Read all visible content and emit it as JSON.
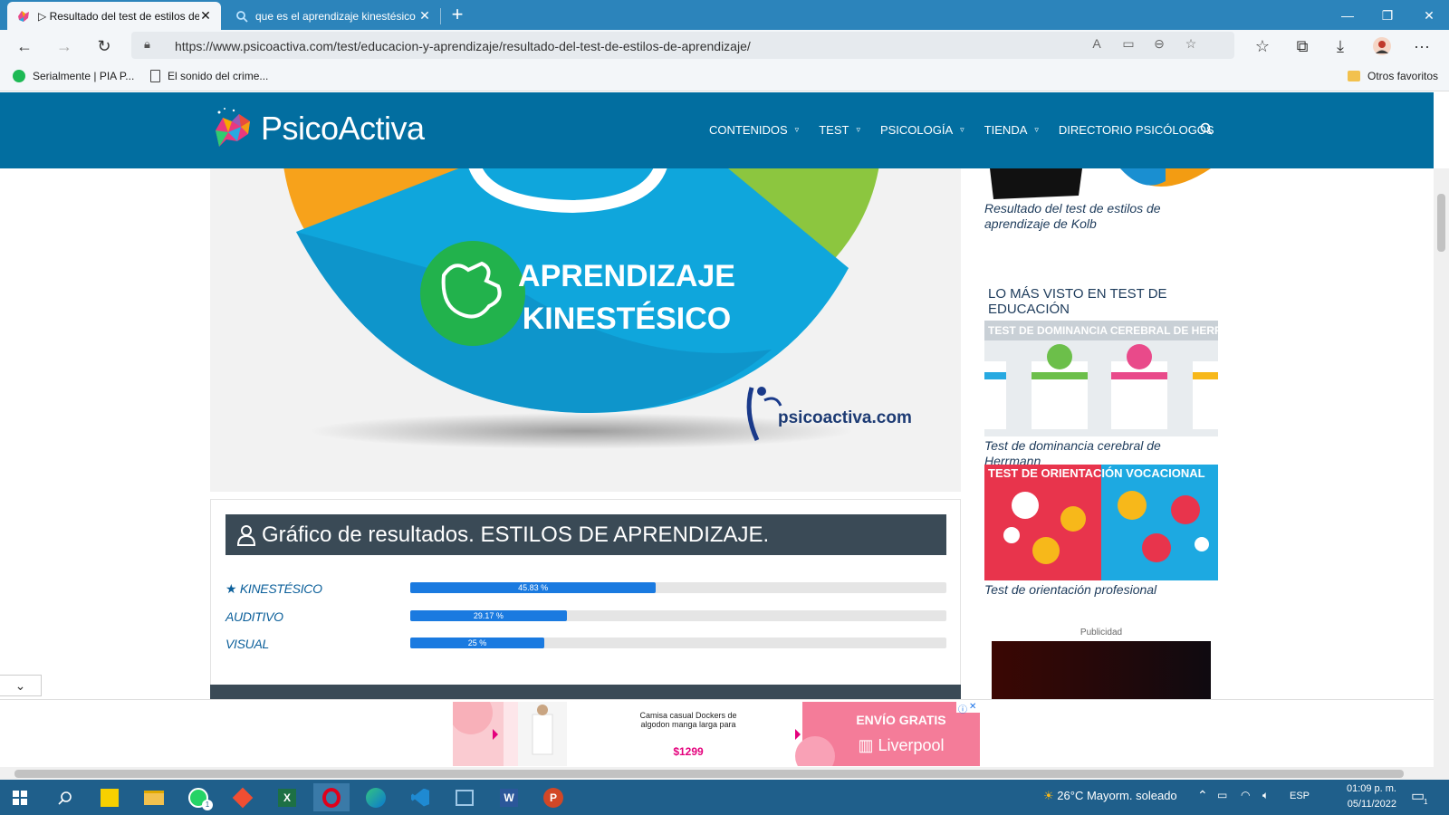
{
  "browser": {
    "tabs": [
      {
        "title": "▷ Resultado del test de estilos de aprendizaje",
        "active": true
      },
      {
        "title": "que es el aprendizaje kinestésico",
        "active": false
      }
    ],
    "url": "https://www.psicoactiva.com/test/educacion-y-aprendizaje/resultado-del-test-de-estilos-de-aprendizaje/",
    "bookmarks": [
      {
        "label": "Serialmente | PIA P...",
        "icon": "spotify-icon"
      },
      {
        "label": "El sonido del crime...",
        "icon": "document-icon"
      }
    ],
    "other_favorites": "Otros favoritos"
  },
  "site": {
    "logo_text": "PsicoActiva",
    "nav": [
      {
        "label": "CONTENIDOS",
        "has_dropdown": true
      },
      {
        "label": "TEST",
        "has_dropdown": true
      },
      {
        "label": "PSICOLOGÍA",
        "has_dropdown": true
      },
      {
        "label": "TIENDA",
        "has_dropdown": true
      },
      {
        "label": "DIRECTORIO PSICÓLOGOS",
        "has_dropdown": false
      }
    ]
  },
  "hero": {
    "line1": "APRENDIZAJE",
    "line2": "KINESTÉSICO",
    "brand": "psicoactiva.com"
  },
  "results": {
    "title": "Gráfico de resultados. ESTILOS DE APRENDIZAJE.",
    "items": [
      {
        "label": "KINESTÉSICO",
        "percent": 45.83,
        "percent_label": "45.83 %",
        "starred": true
      },
      {
        "label": "AUDITIVO",
        "percent": 29.17,
        "percent_label": "29.17 %",
        "starred": false
      },
      {
        "label": "VISUAL",
        "percent": 25,
        "percent_label": "25 %",
        "starred": false
      }
    ],
    "bar_color": "#1a7ae0"
  },
  "sidebar": {
    "top_caption": "Resultado del test de estilos de aprendizaje de Kolb",
    "heading": "LO MÁS VISTO EN TEST DE EDUCACIÓN",
    "cards": [
      {
        "image_text": "TEST DE DOMINANCIA CEREBRAL DE HERRMANN",
        "caption": "Test de dominancia cerebral de Herrmann"
      },
      {
        "image_text": "TEST DE ORIENTACIÓN VOCACIONAL",
        "caption": "Test de orientación profesional"
      }
    ],
    "ad_label": "Publicidad"
  },
  "ad_banner": {
    "product": "Camisa casual Dockers de algodon manga larga para",
    "price": "$1299",
    "promo": "ENVÍO GRATIS",
    "store": "Liverpool"
  },
  "taskbar": {
    "weather": "26°C  Mayorm. soleado",
    "lang": "ESP",
    "time": "01:09 p. m.",
    "date": "05/11/2022",
    "whatsapp_badge": "1",
    "notifications": "1"
  },
  "colors": {
    "site_header": "#026ea0",
    "section_header": "#3a4a56",
    "taskbar": "#1f5f8b",
    "tabbar": "#2c84bb"
  }
}
